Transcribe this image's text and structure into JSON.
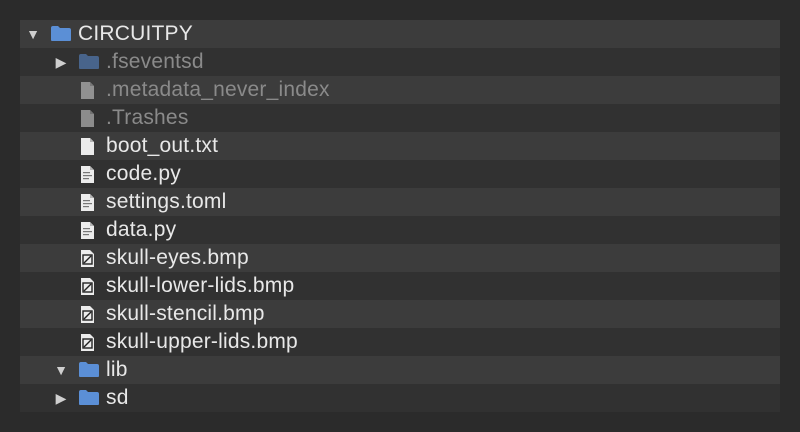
{
  "tree": {
    "root": {
      "label": "CIRCUITPY",
      "expanded": true,
      "icon": "folder-icon"
    },
    "items": [
      {
        "label": ".fseventsd",
        "type": "folder",
        "expanded": false,
        "hidden": true
      },
      {
        "label": ".metadata_never_index",
        "type": "file",
        "hidden": true
      },
      {
        "label": ".Trashes",
        "type": "file",
        "hidden": true
      },
      {
        "label": "boot_out.txt",
        "type": "file"
      },
      {
        "label": "code.py",
        "type": "script"
      },
      {
        "label": "settings.toml",
        "type": "script"
      },
      {
        "label": "data.py",
        "type": "script"
      },
      {
        "label": "skull-eyes.bmp",
        "type": "image"
      },
      {
        "label": "skull-lower-lids.bmp",
        "type": "image"
      },
      {
        "label": "skull-stencil.bmp",
        "type": "image"
      },
      {
        "label": "skull-upper-lids.bmp",
        "type": "image"
      },
      {
        "label": "lib",
        "type": "folder",
        "expanded": true
      },
      {
        "label": "sd",
        "type": "folder",
        "expanded": false
      }
    ]
  },
  "colors": {
    "background": "#2b2b2b",
    "row_odd": "#3c3c3c",
    "row_even": "#313131",
    "folder": "#5b8fd6",
    "text": "#e8e8e8",
    "text_hidden": "#8a8a8a"
  }
}
